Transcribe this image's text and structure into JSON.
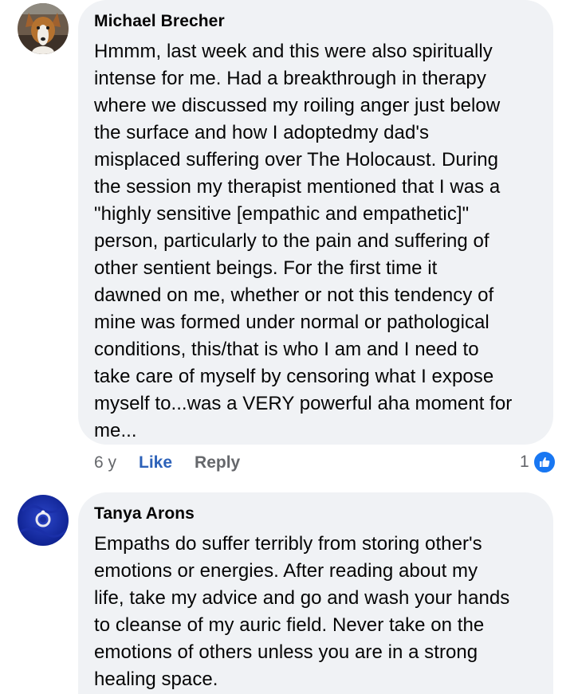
{
  "comments": [
    {
      "author": "Michael Brecher",
      "avatar_icon": "dog-avatar",
      "text": "Hmmm, last week and this were also spiritually\nintense for me. Had a breakthrough in therapy\nwhere we discussed my roiling anger just below\nthe surface and how I adoptedmy dad's\nmisplaced suffering over The Holocaust.  During\nthe session my therapist mentioned that I was a\n\"highly sensitive [empathic and empathetic]\"\nperson, particularly to the pain and suffering of\nother sentient beings.  For the first time it\ndawned on me, whether or not this tendency of\nmine was formed under normal or pathological\nconditions, this/that is who I am and I need to\ntake care of myself by censoring what I expose\nmyself to...was a VERY powerful aha moment for\nme...",
      "time": "6 y",
      "like_label": "Like",
      "reply_label": "Reply",
      "reaction_count": "1",
      "reaction_icon": "thumbs-up-icon"
    },
    {
      "author": "Tanya Arons",
      "avatar_icon": "ring-avatar",
      "text": "Empaths do suffer terribly from storing other's\nemotions or energies.  After reading about my\nlife, take my advice and go and wash your hands\nto cleanse of my auric field.  Never take on the\nemotions of others unless you are in a strong\nhealing space."
    }
  ],
  "colors": {
    "bubble": "#f0f2f5",
    "like_blue": "#2d62b9",
    "badge_blue": "#1877f2",
    "muted": "#65676b"
  }
}
